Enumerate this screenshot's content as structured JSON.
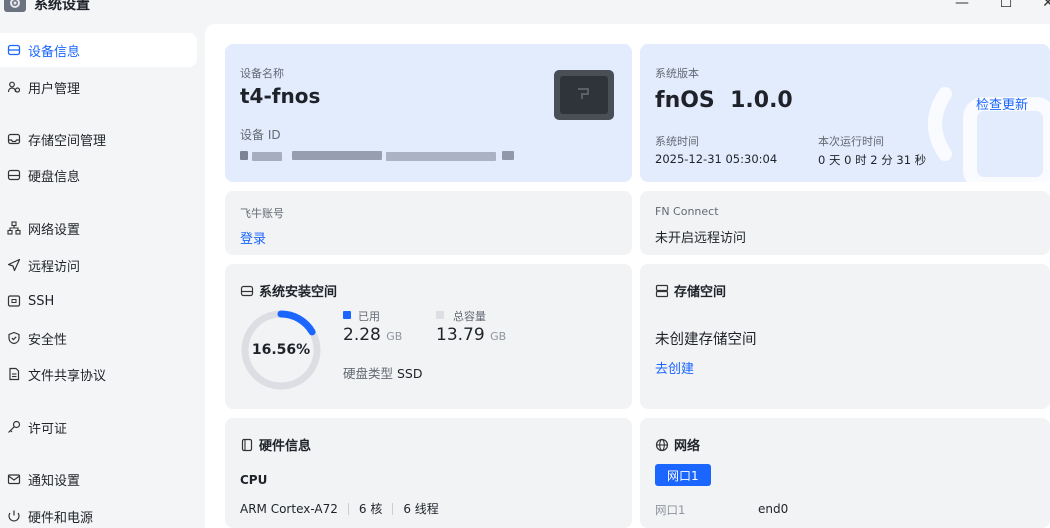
{
  "window": {
    "title": "系统设置",
    "minimize": "—",
    "maximize": "☐",
    "close": "✕"
  },
  "sidebar": {
    "items": [
      {
        "label": "设备信息",
        "icon": "device-icon",
        "active": true
      },
      {
        "label": "用户管理",
        "icon": "users-icon"
      },
      {
        "label": "存储空间管理",
        "icon": "storage-icon"
      },
      {
        "label": "硬盘信息",
        "icon": "disk-icon"
      },
      {
        "label": "网络设置",
        "icon": "network-icon"
      },
      {
        "label": "远程访问",
        "icon": "remote-icon"
      },
      {
        "label": "SSH",
        "icon": "ssh-icon"
      },
      {
        "label": "安全性",
        "icon": "shield-icon"
      },
      {
        "label": "文件共享协议",
        "icon": "file-share-icon"
      },
      {
        "label": "许可证",
        "icon": "key-icon"
      },
      {
        "label": "通知设置",
        "icon": "mail-icon"
      },
      {
        "label": "硬件和电源",
        "icon": "power-icon"
      }
    ]
  },
  "device": {
    "name_label": "设备名称",
    "name": "t4-fnos",
    "id_label": "设备 ID",
    "id_value": "redacted"
  },
  "system": {
    "version_label": "系统版本",
    "version": "fnOS  1.0.0",
    "check_update": "检查更新",
    "time_label": "系统时间",
    "time_value": "2025-12-31 05:30:04",
    "uptime_label": "本次运行时间",
    "uptime_value": "0 天 0 时 2 分 31 秒"
  },
  "account": {
    "label": "飞牛账号",
    "login": "登录"
  },
  "fn_connect": {
    "label": "FN Connect",
    "status": "未开启远程访问"
  },
  "install_space": {
    "title": "系统安装空间",
    "percent_text": "16.56%",
    "percent": 16.56,
    "used_label": "已用",
    "used_value": "2.28",
    "used_unit": "GB",
    "total_label": "总容量",
    "total_value": "13.79",
    "total_unit": "GB",
    "disk_type_label": "硬盘类型",
    "disk_type": "SSD",
    "used_color": "#1a66ff",
    "track_color": "#dcdee3"
  },
  "storage": {
    "title": "存储空间",
    "empty": "未创建存储空间",
    "create": "去创建"
  },
  "hardware": {
    "title": "硬件信息",
    "cpu_label": "CPU",
    "cpu_model": "ARM Cortex-A72",
    "cores": "6 核",
    "threads": "6 线程"
  },
  "network": {
    "title": "网络",
    "tab": "网口1",
    "port_label": "网口1",
    "port_value": "end0"
  }
}
